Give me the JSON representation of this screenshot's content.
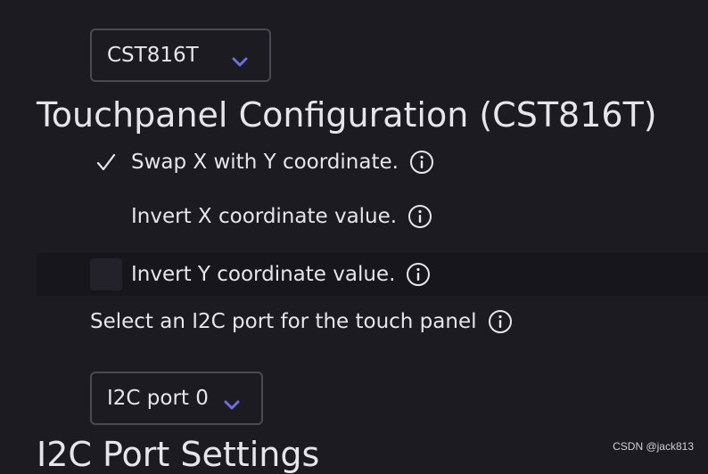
{
  "controller_select": {
    "value": "CST816T"
  },
  "touchpanel": {
    "heading": "Touchpanel Configuration (CST816T)",
    "options": [
      {
        "label": "Swap X with Y coordinate.",
        "checked": true
      },
      {
        "label": "Invert X coordinate value.",
        "checked": false
      },
      {
        "label": "Invert Y coordinate value.",
        "checked": false
      }
    ]
  },
  "i2c": {
    "prompt": "Select an I2C port for the touch panel",
    "select_value": "I2C port 0",
    "next_heading": "I2C Port Settings"
  },
  "watermark": "CSDN @jack813",
  "colors": {
    "background": "#1c1b22",
    "text": "#e6e6ea",
    "chevron": "#6b6fe0",
    "border": "#4a4a55"
  },
  "icons": {
    "chevron": "chevron-down-icon",
    "check": "checkmark-icon",
    "info": "info-icon"
  }
}
